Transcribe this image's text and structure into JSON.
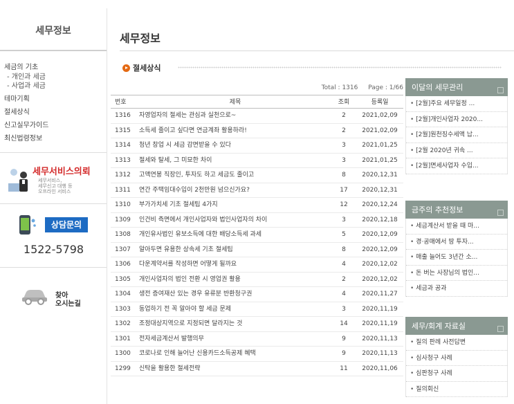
{
  "sidebar": {
    "title": "세무정보",
    "menu": [
      {
        "label": "세금의 기초",
        "subs": [
          "- 개인과 세금",
          "- 사업과 세금"
        ]
      },
      {
        "label": "테마기획"
      },
      {
        "label": "절세상식"
      },
      {
        "label": "신고실무가이드"
      },
      {
        "label": "최신법령정보"
      }
    ],
    "service_banner": {
      "title": "세무서비스의뢰",
      "desc_lines": [
        "세무서비스,",
        "세무신고 대행 등",
        "오프라인 서비스"
      ]
    },
    "consult_banner": {
      "button": "상담문의",
      "phone": "1522-5798"
    },
    "map_banner": {
      "line1": "찾아",
      "line2": "오시는길"
    }
  },
  "main": {
    "page_title": "세무정보",
    "section_title": "절세상식",
    "total": "Total : 1316",
    "page": "Page : 1/66",
    "columns": [
      "번호",
      "제목",
      "조회",
      "등록일"
    ],
    "rows": [
      {
        "no": "1316",
        "title": "자영업자의 절세는 관심과 실천으로~",
        "views": "2",
        "date": "2021,02,09"
      },
      {
        "no": "1315",
        "title": "소득세 줄이고 싶다면 연금계좌 활용하라!",
        "views": "2",
        "date": "2021,02,09"
      },
      {
        "no": "1314",
        "title": "청년 창업 시 세금 감면받을 수 있다",
        "views": "3",
        "date": "2021,01,25"
      },
      {
        "no": "1313",
        "title": "절세와 탈세, 그 미묘한 차이",
        "views": "3",
        "date": "2021,01,25"
      },
      {
        "no": "1312",
        "title": "고액연봉 직장인, 투자도 하고 세금도 줄이고",
        "views": "8",
        "date": "2020,12,31"
      },
      {
        "no": "1311",
        "title": "연간 주택임대수입이 2천만원 넘으신가요?",
        "views": "17",
        "date": "2020,12,31"
      },
      {
        "no": "1310",
        "title": "부가가치세 기초 절세팁 4가지",
        "views": "12",
        "date": "2020,12,24"
      },
      {
        "no": "1309",
        "title": "인건비 측면에서 개인사업자와 법인사업자의 차이",
        "views": "3",
        "date": "2020,12,18"
      },
      {
        "no": "1308",
        "title": "개인유사법인 유보소득에 대한 배당소득세 과세",
        "views": "5",
        "date": "2020,12,09"
      },
      {
        "no": "1307",
        "title": "알아두면 유용한 상속세 기초 절세팁",
        "views": "8",
        "date": "2020,12,09"
      },
      {
        "no": "1306",
        "title": "다운계약서를 작성하면 어떻게 될까요",
        "views": "4",
        "date": "2020,12,02"
      },
      {
        "no": "1305",
        "title": "개인사업자의 법인 전환 시 영업권 활용",
        "views": "2",
        "date": "2020,12,02"
      },
      {
        "no": "1304",
        "title": "생전 증여재산 있는 경우 유류분 반환청구권",
        "views": "4",
        "date": "2020,11,27"
      },
      {
        "no": "1303",
        "title": "동업하기 전 꼭 알아야 할 세금 문제",
        "views": "3",
        "date": "2020,11,19"
      },
      {
        "no": "1302",
        "title": "조정대상지역으로 지정되면 달라지는 것",
        "views": "14",
        "date": "2020,11,19"
      },
      {
        "no": "1301",
        "title": "전자세금계산서 발행의무",
        "views": "9",
        "date": "2020,11,13"
      },
      {
        "no": "1300",
        "title": "코로나로 인해 늘어난 신용카드소득공제 혜택",
        "views": "9",
        "date": "2020,11,13"
      },
      {
        "no": "1299",
        "title": "신탁을 활용한 절세전략",
        "views": "11",
        "date": "2020,11,06"
      }
    ]
  },
  "panels": [
    {
      "title": "이달의 세무관리",
      "items": [
        "[2월]주요 세무일정 ...",
        "[2월]개인사업자 2020...",
        "[2월]원천징수세액 납...",
        "[2월 2020년 귀속 ...",
        "[2월]면세사업자 수입..."
      ]
    },
    {
      "title": "금주의 추천정보",
      "items": [
        "세금계산서 받을 때 마...",
        "경·공매에서 땅 투자...",
        "매출 늘어도 3년간 소...",
        "돈 버는 사장님의 법인...",
        "세금과 공과"
      ]
    },
    {
      "title": "세무/회계 자료실",
      "items": [
        "질의 판례 사전답변",
        "심사청구 사례",
        "심판청구 사례",
        "질의회신"
      ]
    }
  ],
  "colors": {
    "accent_orange": "#e46a14",
    "panel_head": "#8a9992",
    "service_red": "#d42b2b",
    "consult_blue": "#1d6bc3"
  }
}
